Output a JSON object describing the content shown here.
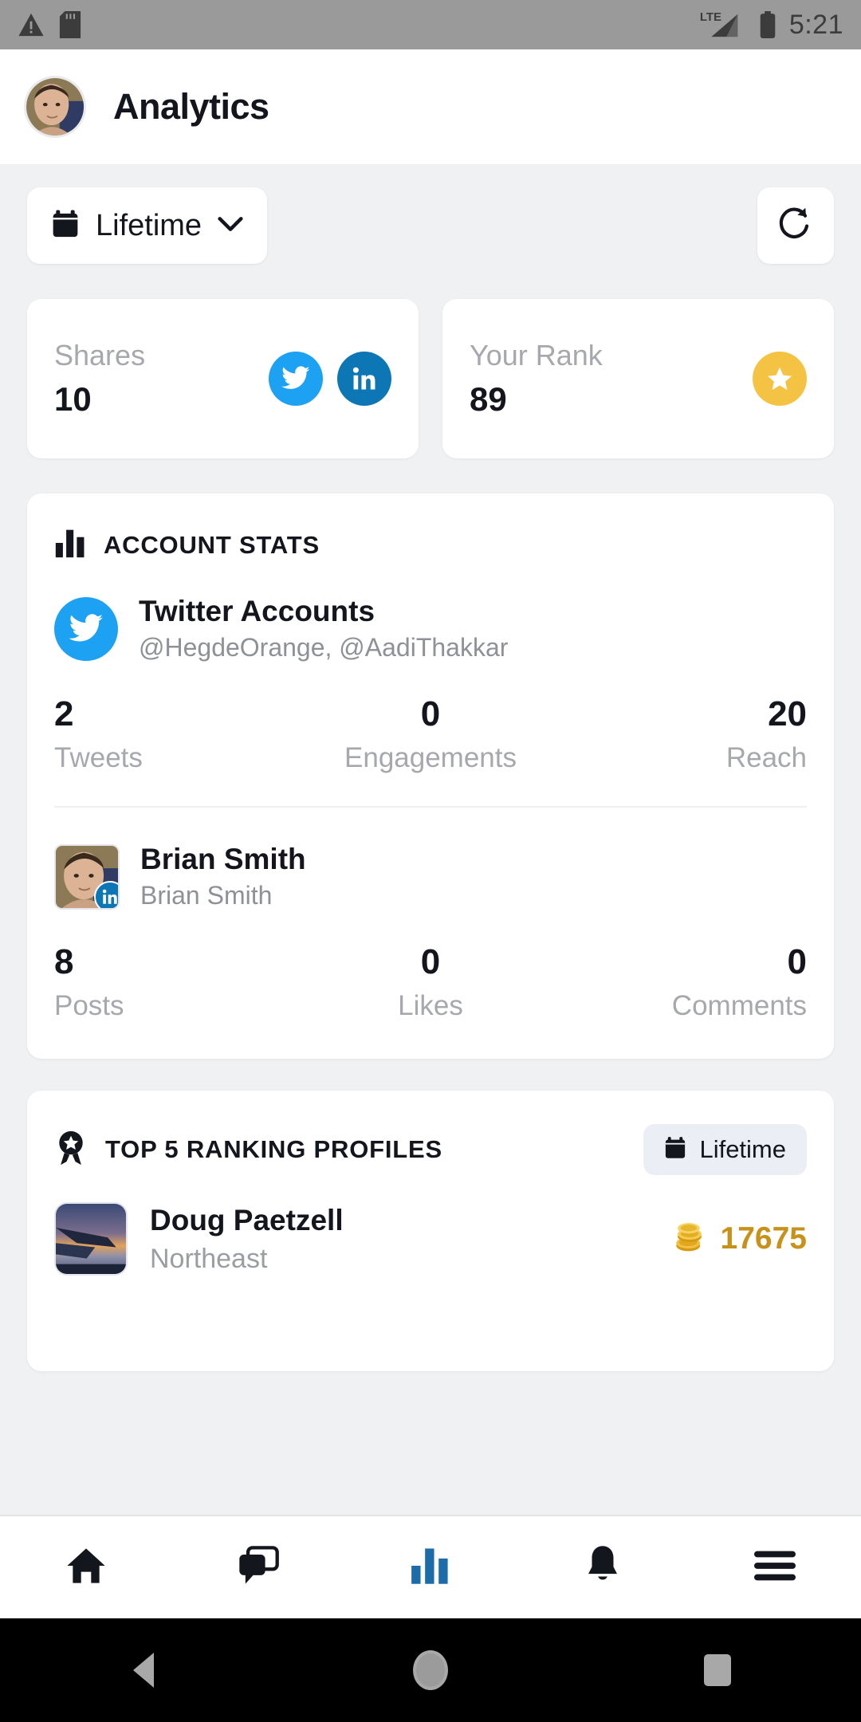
{
  "status_bar": {
    "time": "5:21",
    "network": "LTE",
    "icons": [
      "warning-icon",
      "sd-card-icon",
      "signal-icon",
      "battery-icon"
    ]
  },
  "app_bar": {
    "title": "Analytics",
    "avatar": "user-avatar-photo"
  },
  "toolbar": {
    "period_label": "Lifetime",
    "calendar_icon": "calendar-icon",
    "chevron_icon": "chevron-down-icon",
    "refresh_icon": "refresh-icon"
  },
  "kpi": [
    {
      "label": "Shares",
      "value": "10",
      "icons": [
        "twitter-icon",
        "linkedin-icon"
      ]
    },
    {
      "label": "Your Rank",
      "value": "89",
      "icons": [
        "star-icon"
      ]
    }
  ],
  "account_stats": {
    "title": "ACCOUNT STATS",
    "icon": "bar-chart-icon",
    "accounts": [
      {
        "name": "Twitter Accounts",
        "handles": "@HegdeOrange, @AadiThakkar",
        "avatar_type": "twitter-logo",
        "metrics": [
          {
            "value": "2",
            "label": "Tweets"
          },
          {
            "value": "0",
            "label": "Engagements"
          },
          {
            "value": "20",
            "label": "Reach"
          }
        ]
      },
      {
        "name": "Brian Smith",
        "handles": "Brian Smith",
        "avatar_type": "photo",
        "badge": "linkedin-icon",
        "metrics": [
          {
            "value": "8",
            "label": "Posts"
          },
          {
            "value": "0",
            "label": "Likes"
          },
          {
            "value": "0",
            "label": "Comments"
          }
        ]
      }
    ]
  },
  "ranking": {
    "title": "TOP 5 RANKING PROFILES",
    "icon": "award-ribbon-icon",
    "period_label": "Lifetime",
    "calendar_icon": "calendar-icon",
    "profiles": [
      {
        "name": "Doug Paetzell",
        "region": "Northeast",
        "score": "17675",
        "score_icon": "coins-icon"
      }
    ]
  },
  "bottom_nav": [
    {
      "name": "home",
      "icon": "home-icon",
      "active": false
    },
    {
      "name": "messages",
      "icon": "chat-icon",
      "active": false
    },
    {
      "name": "analytics",
      "icon": "bar-chart-icon",
      "active": true
    },
    {
      "name": "notifications",
      "icon": "bell-icon",
      "active": false
    },
    {
      "name": "menu",
      "icon": "hamburger-icon",
      "active": false
    }
  ],
  "android_nav": [
    {
      "name": "back",
      "icon": "back-triangle-icon"
    },
    {
      "name": "home",
      "icon": "home-circle-icon"
    },
    {
      "name": "recents",
      "icon": "recents-square-icon"
    }
  ],
  "colors": {
    "twitter": "#1DA1F2",
    "linkedin": "#0D76B4",
    "star": "#F5C344",
    "gold": "#C8921A",
    "accent": "#1B6CA8",
    "background": "#F0F1F3"
  }
}
